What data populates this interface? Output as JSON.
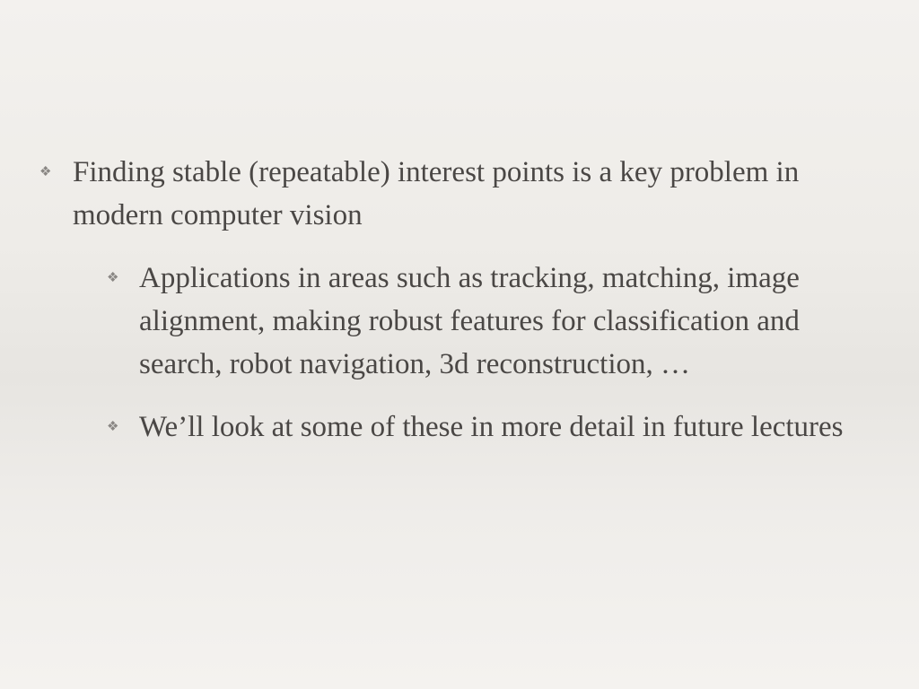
{
  "slide": {
    "marker_glyph": "❖",
    "bullets": [
      {
        "level": 1,
        "text": "Finding stable (repeatable) interest points is a key problem in modern computer vision"
      },
      {
        "level": 2,
        "text": "Applications in areas such as tracking, matching, image alignment, making robust features for classification and search, robot navigation, 3d reconstruction, …"
      },
      {
        "level": 2,
        "text": "We’ll look at some of these in more detail in future lectures"
      }
    ]
  }
}
